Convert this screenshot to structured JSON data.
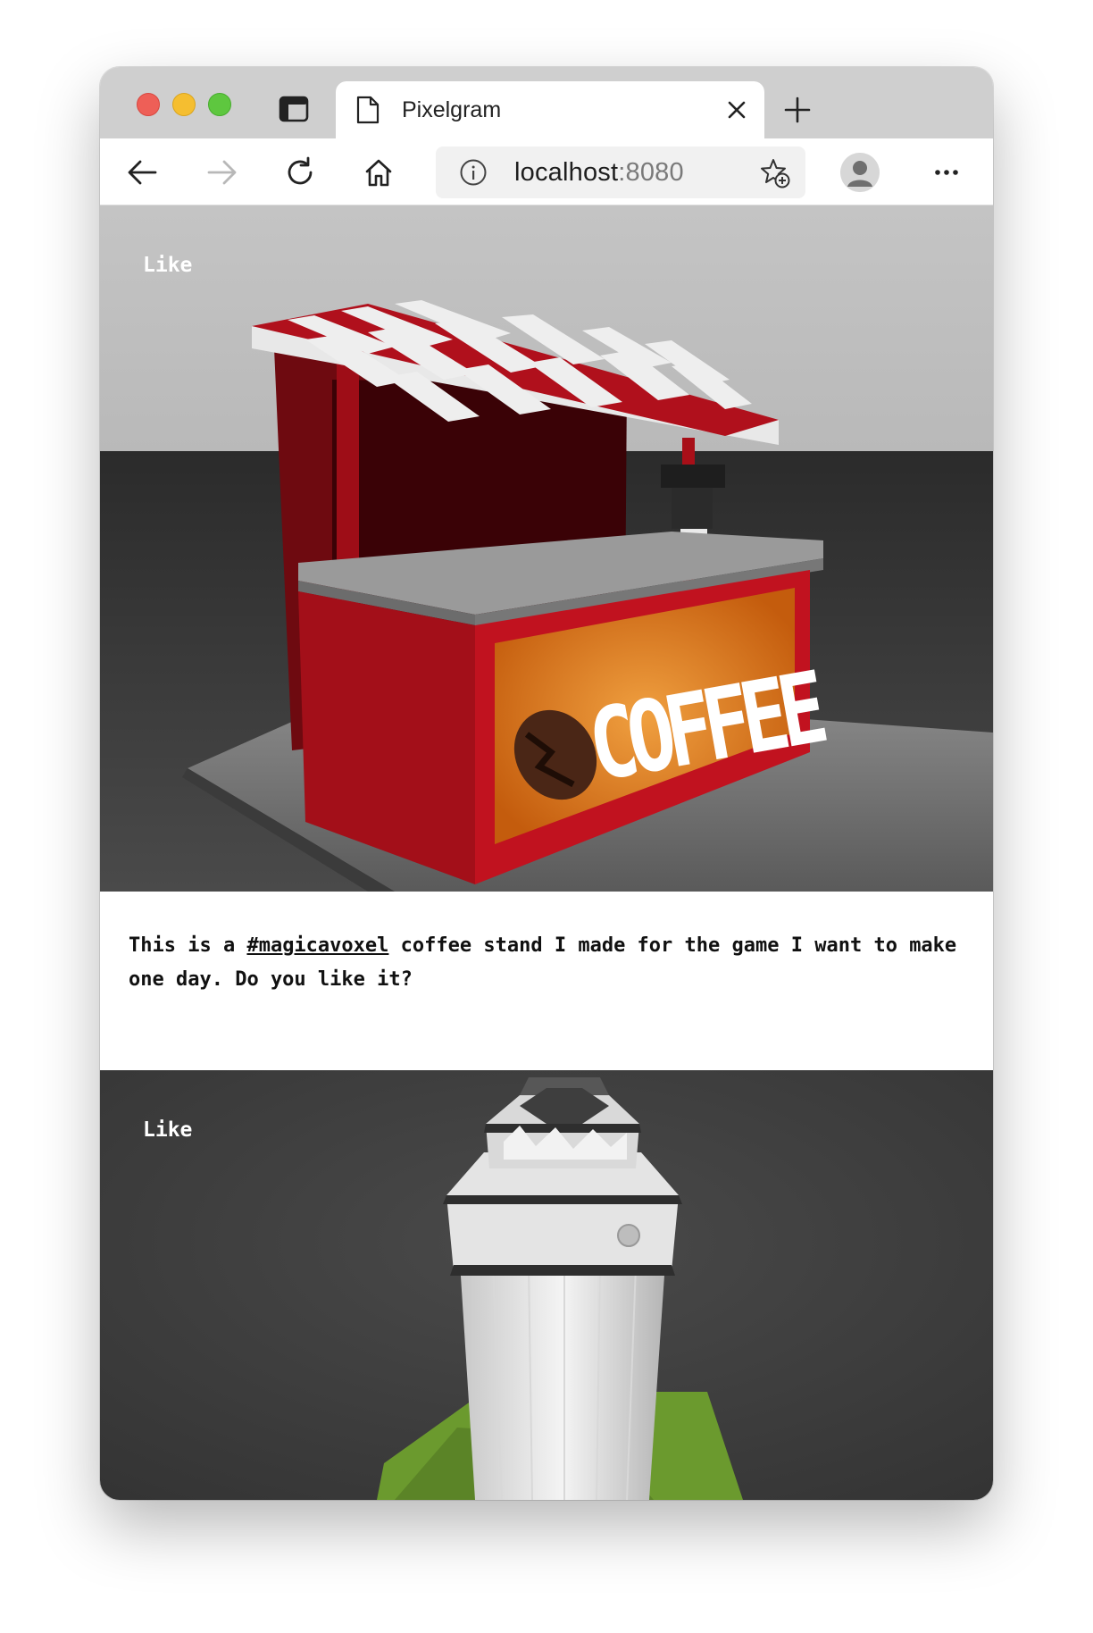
{
  "browser": {
    "tab_title": "Pixelgram",
    "url_host": "localhost",
    "url_port": ":8080"
  },
  "posts": [
    {
      "like_label": "Like",
      "image_subject": "voxel coffee stand",
      "image_text": "COFFEE",
      "caption_before": "This is a ",
      "hashtag": "#magicavoxel",
      "caption_after": " coffee stand I made for the game I want to make one day. Do you like it?"
    },
    {
      "like_label": "Like",
      "image_subject": "voxel white tower"
    }
  ],
  "colors": {
    "tabstrip": "#cfcfcf",
    "awning_red": "#b0101c",
    "stand_red": "#c1121f",
    "sign_orange": "#d36f12"
  }
}
